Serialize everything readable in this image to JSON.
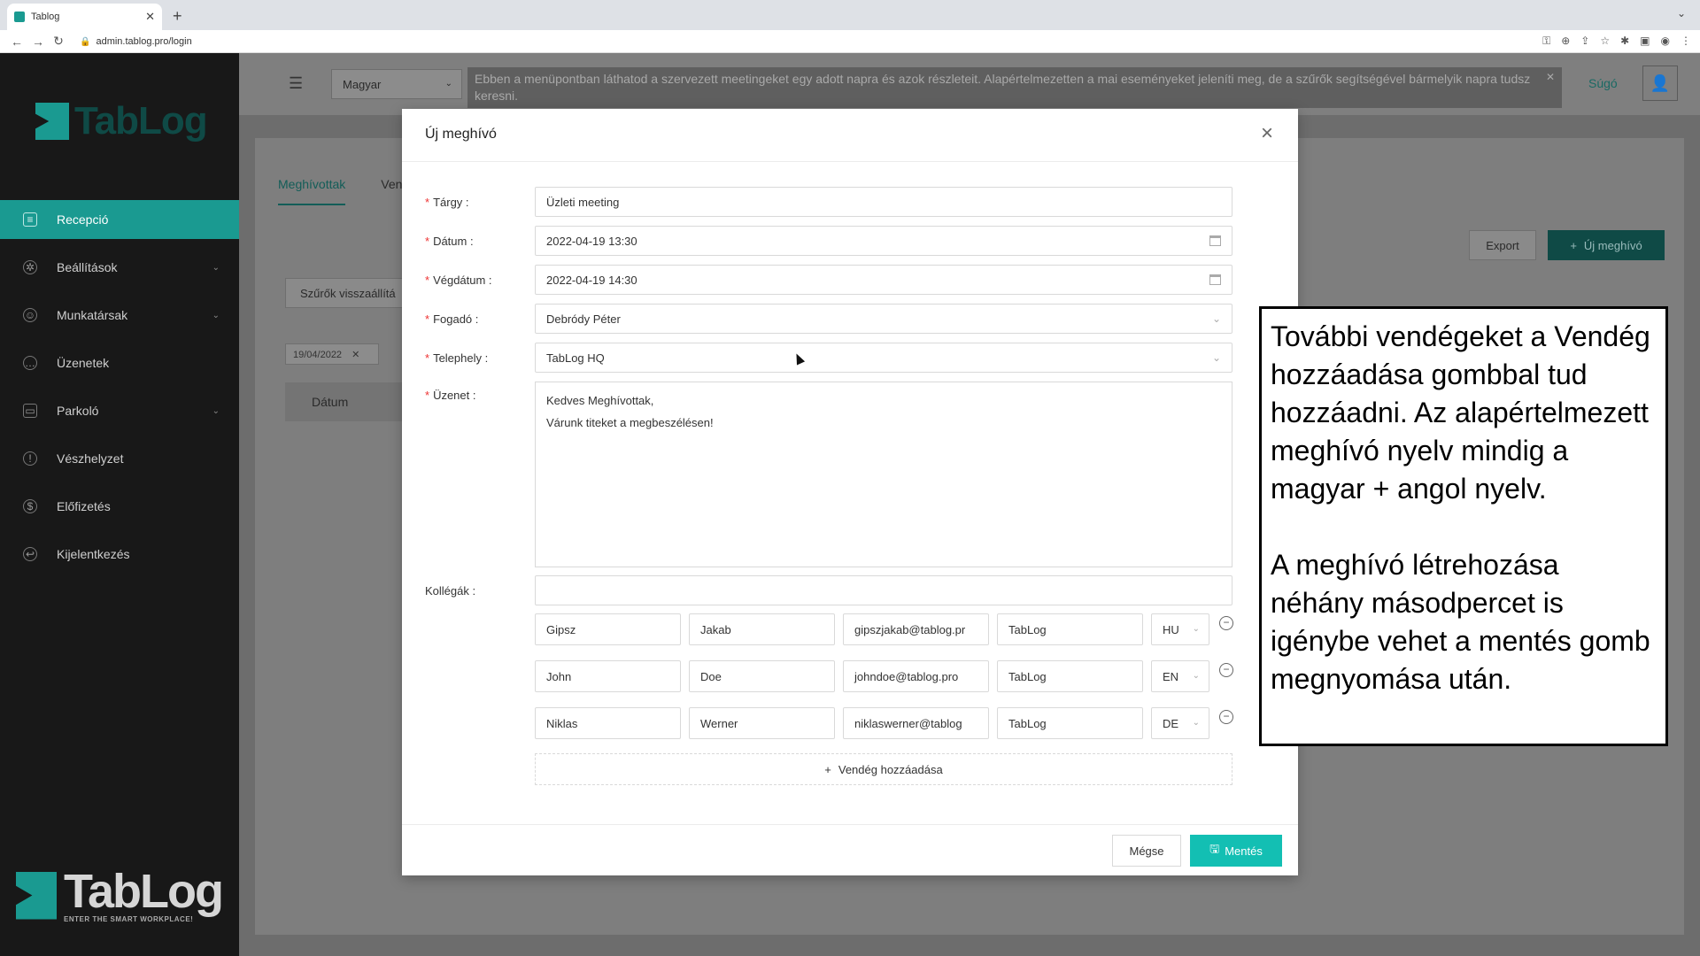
{
  "browser": {
    "tab_title": "Tablog",
    "url": "admin.tablog.pro/login"
  },
  "sidebar": {
    "logo_top": "TabLog",
    "items": [
      {
        "label": "Recepció",
        "icon": "document-icon",
        "active": true
      },
      {
        "label": "Beállítások",
        "icon": "gear-icon",
        "chevron": true
      },
      {
        "label": "Munkatársak",
        "icon": "user-icon",
        "chevron": true
      },
      {
        "label": "Üzenetek",
        "icon": "chat-icon"
      },
      {
        "label": "Parkoló",
        "icon": "car-icon",
        "chevron": true
      },
      {
        "label": "Vészhelyzet",
        "icon": "alert-icon"
      },
      {
        "label": "Előfizetés",
        "icon": "dollar-icon"
      },
      {
        "label": "Kijelentkezés",
        "icon": "logout-icon"
      }
    ],
    "logo_bottom": {
      "word": "TabLog",
      "tagline": "ENTER THE SMART WORKPLACE!"
    }
  },
  "header": {
    "language": "Magyar",
    "info": "Ebben a menüpontban láthatod a szervezett meetingeket egy adott napra és azok részleteit. Alapértelmezetten a mai eseményeket jeleníti meg, de a szűrők segítségével bármelyik napra tudsz keresni.",
    "help": "Súgó"
  },
  "content": {
    "tabs": [
      "Meghívottak",
      "Ven"
    ],
    "export": "Export",
    "new_invite": "Új meghívó",
    "reset_filters": "Szűrők visszaállítá",
    "date_chip": "19/04/2022",
    "table_header": "Dátum"
  },
  "modal": {
    "title": "Új meghívó",
    "fields": {
      "subject_label": "Tárgy :",
      "subject_value": "Üzleti meeting",
      "date_label": "Dátum :",
      "date_value": "2022-04-19 13:30",
      "end_label": "Végdátum :",
      "end_value": "2022-04-19 14:30",
      "host_label": "Fogadó :",
      "host_value": "Debródy Péter",
      "site_label": "Telephely :",
      "site_value": "TabLog HQ",
      "message_label": "Üzenet :",
      "message_line1": "Kedves Meghívottak,",
      "message_line2": "Várunk titeket a megbeszélésen!",
      "colleagues_label": "Kollégák :"
    },
    "guests": [
      {
        "last": "Gipsz",
        "first": "Jakab",
        "email": "gipszjakab@tablog.pr",
        "company": "TabLog",
        "lang": "HU"
      },
      {
        "last": "John",
        "first": "Doe",
        "email": "johndoe@tablog.pro",
        "company": "TabLog",
        "lang": "EN"
      },
      {
        "last": "Niklas",
        "first": "Werner",
        "email": "niklaswerner@tablog",
        "company": "TabLog",
        "lang": "DE"
      }
    ],
    "add_guest": "Vendég hozzáadása",
    "cancel": "Mégse",
    "save": "Mentés"
  },
  "callout": {
    "p1": "További vendégeket a Vendég hozzáadása gombbal tud hozzáadni. Az alapértelmezett meghívó nyelv mindig a magyar + angol nyelv.",
    "p2": "A meghívó létrehozása néhány másodpercet is igénybe vehet a mentés gomb megnyomása után."
  },
  "colors": {
    "accent": "#13bfb3",
    "sidebar_active": "#1a9a91",
    "sidebar_bg": "#181818"
  }
}
